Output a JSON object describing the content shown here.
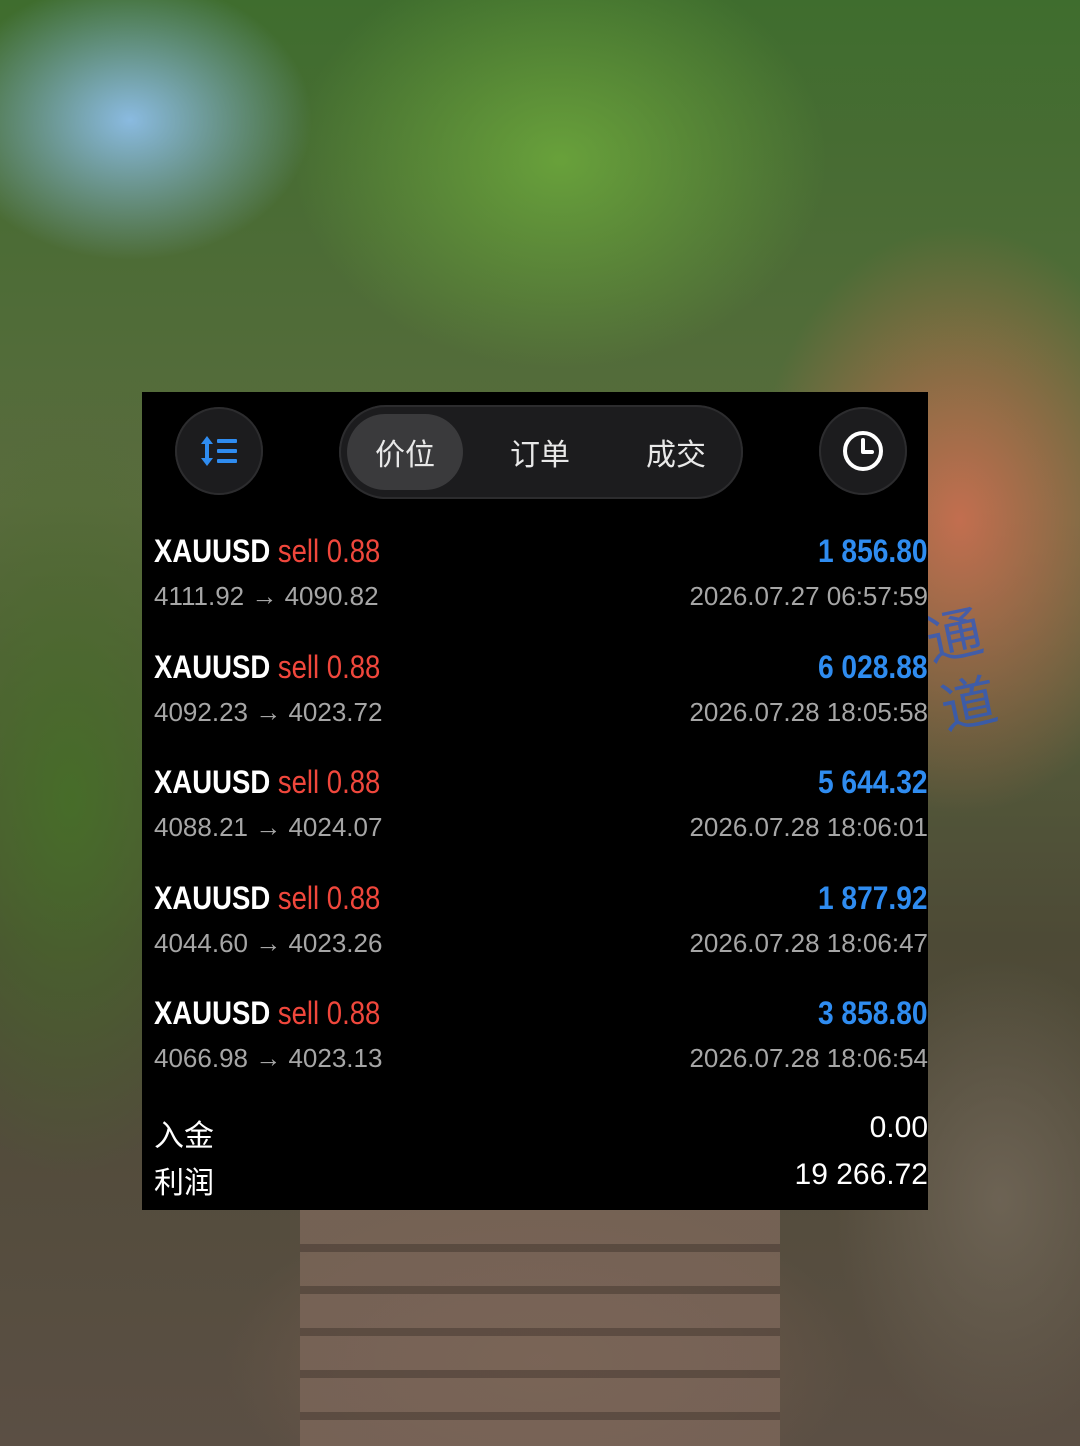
{
  "toolbar": {
    "left_icon": "sort-icon",
    "right_icon": "clock-icon",
    "tabs": [
      {
        "label": "价位",
        "active": true
      },
      {
        "label": "订单",
        "active": false
      },
      {
        "label": "成交",
        "active": false
      }
    ]
  },
  "trades": [
    {
      "symbol": "XAUUSD",
      "side": "sell",
      "volume": "0.88",
      "open_price": "4111.92",
      "close_price": "4090.82",
      "profit": "1 856.80",
      "time": "2026.07.27 06:57:59"
    },
    {
      "symbol": "XAUUSD",
      "side": "sell",
      "volume": "0.88",
      "open_price": "4092.23",
      "close_price": "4023.72",
      "profit": "6 028.88",
      "time": "2026.07.28 18:05:58"
    },
    {
      "symbol": "XAUUSD",
      "side": "sell",
      "volume": "0.88",
      "open_price": "4088.21",
      "close_price": "4024.07",
      "profit": "5 644.32",
      "time": "2026.07.28 18:06:01"
    },
    {
      "symbol": "XAUUSD",
      "side": "sell",
      "volume": "0.88",
      "open_price": "4044.60",
      "close_price": "4023.26",
      "profit": "1 877.92",
      "time": "2026.07.28 18:06:47"
    },
    {
      "symbol": "XAUUSD",
      "side": "sell",
      "volume": "0.88",
      "open_price": "4066.98",
      "close_price": "4023.13",
      "profit": "3 858.80",
      "time": "2026.07.28 18:06:54"
    }
  ],
  "arrow": "→",
  "summary": {
    "deposit_label": "入金",
    "deposit_value": "0.00",
    "profit_label": "利润",
    "profit_value": "19 266.72"
  },
  "background": {
    "rock_text": "通道"
  },
  "colors": {
    "panel_bg": "#000000",
    "sell": "#f0473c",
    "profit": "#2f8cf0",
    "accent_icon": "#2f8cf0",
    "muted_text": "#a6a6a6"
  }
}
